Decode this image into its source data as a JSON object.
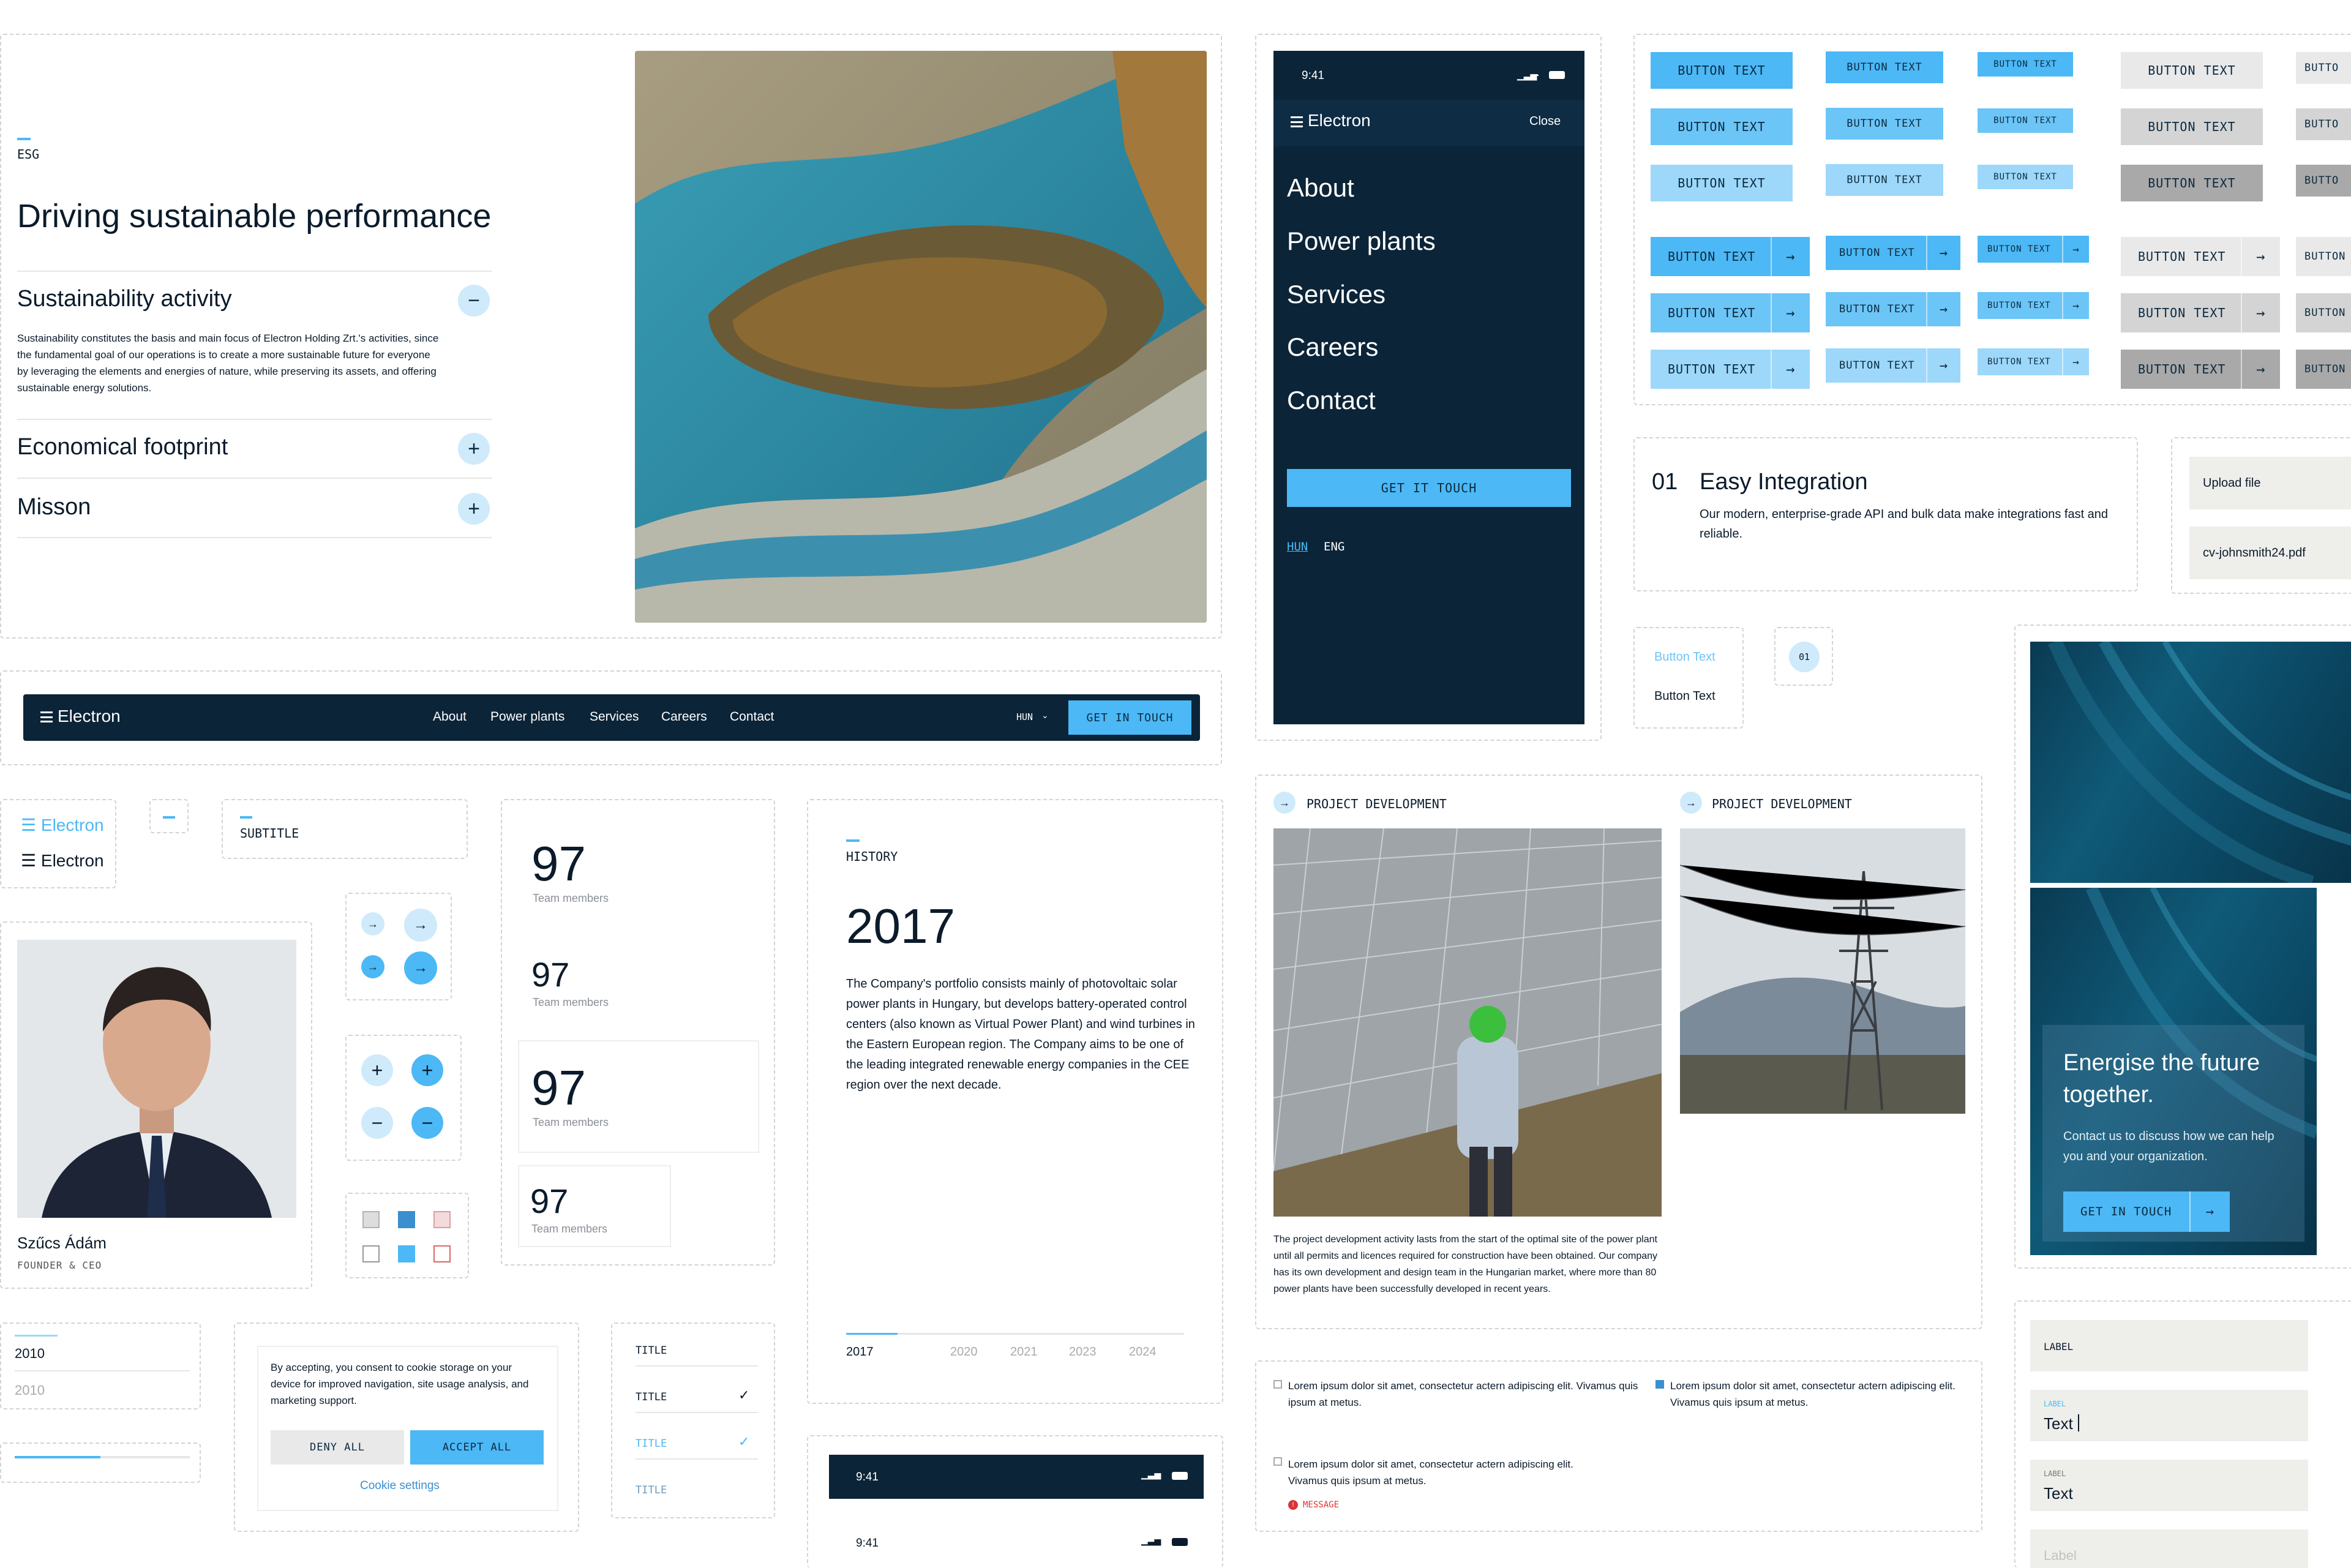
{
  "brand": {
    "name": "Electron",
    "accent": "#4cb8f5",
    "dark": "#0b2438"
  },
  "esg": {
    "eyebrow": "ESG",
    "title": "Driving sustainable performance",
    "items": [
      {
        "title": "Sustainability activity",
        "body": "Sustainability constitutes the basis and main focus of Electron Holding Zrt.'s activities, since the fundamental goal of our operations is to create a more sustainable future for everyone by leveraging the elements and energies of nature, while preserving its assets, and offering sustainable energy solutions.",
        "icon": "minus-icon"
      },
      {
        "title": "Economical footprint",
        "icon": "plus-icon"
      },
      {
        "title": "Misson",
        "icon": "plus-icon"
      }
    ]
  },
  "navbar": {
    "logo": "Electron",
    "links": [
      "About",
      "Power plants",
      "Services",
      "Careers",
      "Contact"
    ],
    "lang": "HUN",
    "cta": "GET IN TOUCH"
  },
  "mobile_menu": {
    "time": "9:41",
    "logo": "Electron",
    "close": "Close",
    "links": [
      "About",
      "Power plants",
      "Services",
      "Careers",
      "Contact"
    ],
    "cta": "GET IT TOUCH",
    "lang_active": "HUN",
    "lang_other": "ENG"
  },
  "buttons": {
    "label": "BUTTON TEXT",
    "partial": "BUTTO",
    "partial2": "BUTTON"
  },
  "integration": {
    "num": "01",
    "title": "Easy Integration",
    "body": "Our modern, enterprise-grade API and bulk data make integrations fast and reliable."
  },
  "upload": {
    "label": "Upload file",
    "file": "cv-johnsmith24.pdf"
  },
  "text_buttons": {
    "hover": "Button Text",
    "normal": "Button Text",
    "pager": "01"
  },
  "logo_variants": [
    "Electron",
    "Electron"
  ],
  "subtitle": "SUBTITLE",
  "person": {
    "name": "Szűcs Ádám",
    "role": "FOUNDER & CEO"
  },
  "stats": [
    {
      "value": "97",
      "label": "Team members"
    },
    {
      "value": "97",
      "label": "Team members"
    },
    {
      "value": "97",
      "label": "Team members"
    },
    {
      "value": "97",
      "label": "Team members"
    }
  ],
  "history": {
    "eyebrow": "HISTORY",
    "year": "2017",
    "body": "The Company's portfolio consists mainly of photovoltaic solar power plants in Hungary, but develops battery-operated control centers (also known as Virtual Power Plant) and wind turbines in the Eastern European region. The Company aims to be one of the leading integrated renewable energy companies in the CEE region over the next decade.",
    "timeline": [
      "2017",
      "2020",
      "2021",
      "2023",
      "2024"
    ]
  },
  "projects": {
    "label1": "PROJECT DEVELOPMENT",
    "label2": "PROJECT DEVELOPMENT",
    "body": "The project development activity lasts from the start of the optimal site of the power plant until all permits and licences required for construction have been obtained. Our company has its own development and design team in the Hungarian market, where more than 80 power plants have been successfully developed in recent years."
  },
  "cta_card": {
    "title": "Energise the future together.",
    "body": "Contact us to discuss how we can help you and your organization.",
    "button": "GET IN TOUCH"
  },
  "years_select": {
    "selected": "2010",
    "option": "2010"
  },
  "cookie": {
    "text": "By accepting, you consent to cookie storage on your device for improved navigation, site usage analysis, and marketing support.",
    "deny": "DENY ALL",
    "accept": "ACCEPT ALL",
    "settings": "Cookie settings"
  },
  "titles_list": [
    "TITLE",
    "TITLE",
    "TITLE",
    "TITLE"
  ],
  "checkboxes": {
    "item1": "Lorem ipsum dolor sit amet, consectetur actern adipiscing elit. Vivamus quis ipsum at metus.",
    "item2": "Lorem ipsum dolor sit amet, consectetur actern adipiscing elit. Vivamus quis ipsum at metus.",
    "item3": "Lorem ipsum dolor sit amet, consectetur actern adipiscing elit. Vivamus quis ipsum at metus.",
    "message": "MESSAGE"
  },
  "form": {
    "label": "LABEL",
    "label_small": "LABEL",
    "value": "Text",
    "label_small2": "LABEL",
    "value2": "Text",
    "placeholder": "Label"
  },
  "status_bar": {
    "time1": "9:41",
    "time2": "9:41"
  }
}
